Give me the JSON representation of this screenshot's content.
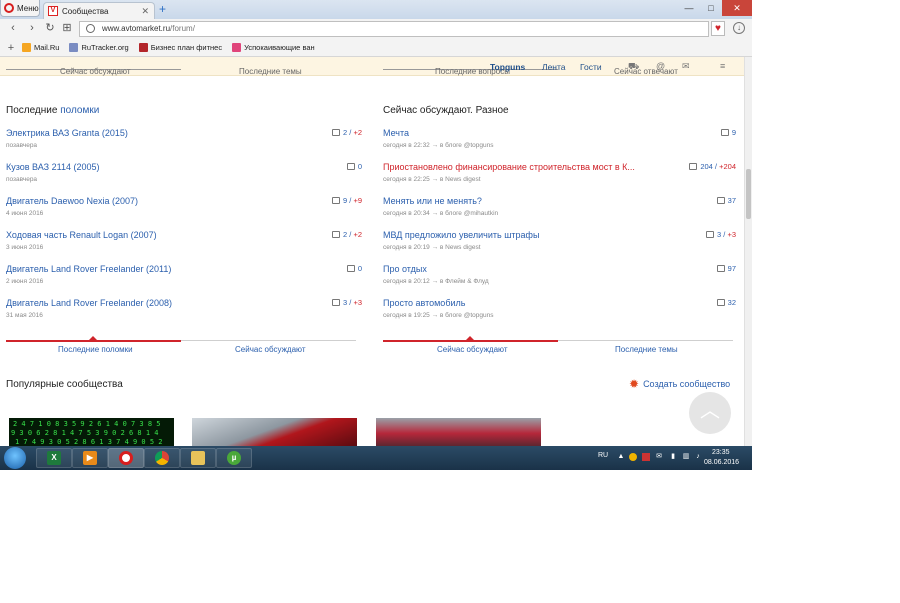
{
  "browser": {
    "menu_label": "Меню",
    "tab_title": "Сообщества",
    "tab_favicon_letter": "V",
    "url_host": "www.avtomarket.ru",
    "url_path": "/forum/",
    "bookmarks": [
      {
        "label": "Mail.Ru",
        "color": "#f5a623"
      },
      {
        "label": "RuTracker.org",
        "color": "#7a8cc2"
      },
      {
        "label": "Бизнес план фитнес",
        "color": "#b3262b"
      },
      {
        "label": "Успокаивающие ван",
        "color": "#e0457b"
      }
    ]
  },
  "site_header": {
    "ghost_tabs": [
      "Сейчас обсуждают",
      "Последние темы",
      "Последние вопросы",
      "Сейчас отвечают"
    ],
    "brand": "Topguns",
    "nav": [
      "Лента",
      "Гости"
    ]
  },
  "breakdowns": {
    "title_prefix": "Последние",
    "title_accent": "поломки",
    "items": [
      {
        "title": "Электрика ВАЗ Granta (2015)",
        "sub": "позавчера",
        "count": "2",
        "plus": "+2"
      },
      {
        "title": "Кузов ВАЗ 2114 (2005)",
        "sub": "позавчера",
        "count": "0",
        "plus": ""
      },
      {
        "title": "Двигатель Daewoo Nexia (2007)",
        "sub": "4 июня 2016",
        "count": "9",
        "plus": "+9"
      },
      {
        "title": "Ходовая часть Renault Logan (2007)",
        "sub": "3 июня 2016",
        "count": "2",
        "plus": "+2"
      },
      {
        "title": "Двигатель Land Rover Freelander (2011)",
        "sub": "2 июня 2016",
        "count": "0",
        "plus": ""
      },
      {
        "title": "Двигатель Land Rover Freelander (2008)",
        "sub": "31 мая 2016",
        "count": "3",
        "plus": "+3"
      }
    ],
    "tabs": [
      "Последние поломки",
      "Сейчас обсуждают"
    ]
  },
  "discussions": {
    "title": "Сейчас обсуждают. Разное",
    "items": [
      {
        "title": "Мечта",
        "sub": "сегодня в 22:32 → в блоге @topguns",
        "count": "9",
        "plus": "",
        "red": false
      },
      {
        "title": "Приостановлено финансирование строительства мост в К...",
        "sub": "сегодня в 22:25 → в News digest",
        "count": "204",
        "plus": "+204",
        "red": true
      },
      {
        "title": "Менять или не менять?",
        "sub": "сегодня в 20:34 → в блоге @mihautkin",
        "count": "37",
        "plus": "",
        "red": false
      },
      {
        "title": "МВД предложило увеличить штрафы",
        "sub": "сегодня в 20:19 → в News digest",
        "count": "3",
        "plus": "+3",
        "red": false
      },
      {
        "title": "Про отдых",
        "sub": "сегодня в 20:12 → в Флейм & Флуд",
        "count": "97",
        "plus": "",
        "red": false
      },
      {
        "title": "Просто автомобиль",
        "sub": "сегодня в 19:25 → в блоге @topguns",
        "count": "32",
        "plus": "",
        "red": false
      }
    ],
    "tabs": [
      "Сейчас обсуждают",
      "Последние темы"
    ]
  },
  "popular": {
    "title": "Популярные сообщества",
    "create_label": "Создать сообщество"
  },
  "taskbar": {
    "lang": "RU",
    "time": "23:35",
    "date": "08.06.2016"
  },
  "colors": {
    "link": "#2b5fad",
    "accent_red": "#d0242b",
    "header_bg": "#fdf5e2"
  }
}
